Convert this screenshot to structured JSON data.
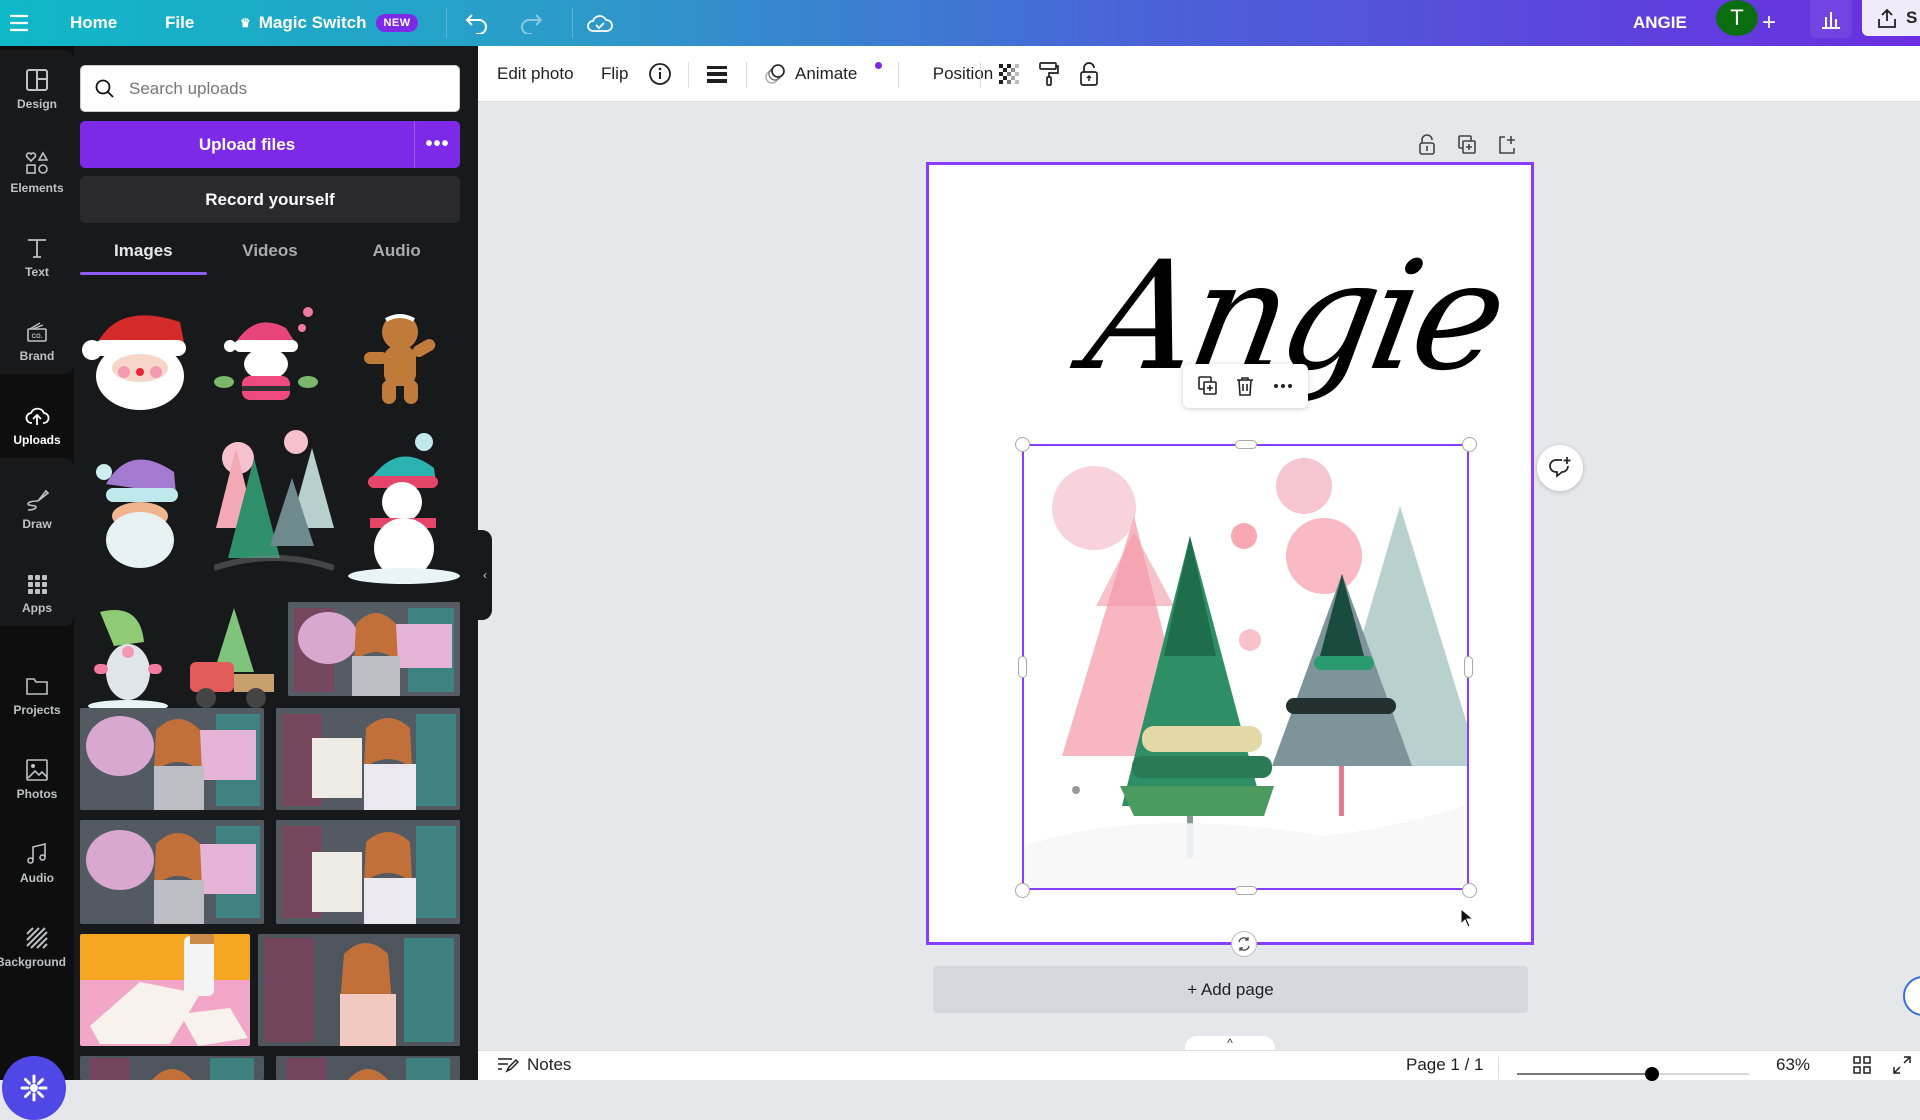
{
  "topbar": {
    "menu_icon": "hamburger-icon",
    "home": "Home",
    "file": "File",
    "magic_switch": "Magic Switch",
    "magic_badge": "NEW",
    "undo_icon": "undo-icon",
    "redo_icon": "redo-icon",
    "save_status_icon": "cloud-check-icon",
    "design_name": "ANGIE",
    "avatar_initial": "T",
    "share_label": "S"
  },
  "rail": {
    "items": [
      {
        "label": "Design",
        "icon": "layout-icon"
      },
      {
        "label": "Elements",
        "icon": "shapes-icon"
      },
      {
        "label": "Text",
        "icon": "text-icon"
      },
      {
        "label": "Brand",
        "icon": "brand-kit-icon"
      },
      {
        "label": "Uploads",
        "icon": "cloud-upload-icon",
        "active": true
      },
      {
        "label": "Draw",
        "icon": "pen-icon"
      },
      {
        "label": "Apps",
        "icon": "apps-grid-icon"
      },
      {
        "label": "Projects",
        "icon": "folder-icon"
      },
      {
        "label": "Photos",
        "icon": "image-icon"
      },
      {
        "label": "Audio",
        "icon": "music-note-icon"
      },
      {
        "label": "Background",
        "icon": "hatch-pattern-icon"
      }
    ]
  },
  "panel": {
    "search_placeholder": "Search uploads",
    "upload_label": "Upload files",
    "upload_more": "•••",
    "record_label": "Record yourself",
    "tabs": [
      {
        "label": "Images",
        "active": true
      },
      {
        "label": "Videos"
      },
      {
        "label": "Audio"
      }
    ],
    "images": [
      {
        "name": "santa-face"
      },
      {
        "name": "santa-pink"
      },
      {
        "name": "gingerbread-man"
      },
      {
        "name": "pastel-santa"
      },
      {
        "name": "pink-green-trees"
      },
      {
        "name": "snowman"
      },
      {
        "name": "gnome"
      },
      {
        "name": "red-truck-tree"
      },
      {
        "name": "photo-woman-floral-sheets-1"
      },
      {
        "name": "photo-woman-floral-sheets-2"
      },
      {
        "name": "photo-woman-pointing-1"
      },
      {
        "name": "photo-woman-floral-sheets-3"
      },
      {
        "name": "photo-woman-pointing-2"
      },
      {
        "name": "photo-paper-sheets-pink"
      },
      {
        "name": "photo-woman-shrug-1"
      },
      {
        "name": "photo-woman-shrug-2"
      },
      {
        "name": "photo-woman-shrug-3"
      }
    ]
  },
  "toolbar": {
    "edit_photo": "Edit photo",
    "flip": "Flip",
    "info_icon": "info-icon",
    "lines_icon": "border-style-icon",
    "animate": "Animate",
    "position": "Position",
    "transparency_icon": "transparency-icon",
    "paint_roller_icon": "copy-style-icon",
    "lock_icon": "lock-icon"
  },
  "canvas": {
    "text_element": "Angie",
    "floating_menu": [
      "duplicate-icon",
      "trash-icon",
      "more-icon"
    ],
    "add_page": "+ Add page"
  },
  "bottombar": {
    "notes": "Notes",
    "page": "Page 1 / 1",
    "zoom_percent": "63%",
    "zoom_fraction": 0.58
  },
  "colors": {
    "accent": "#8b3dff",
    "upload_button": "#7d2ae8",
    "avatar": "#0a6e11"
  }
}
